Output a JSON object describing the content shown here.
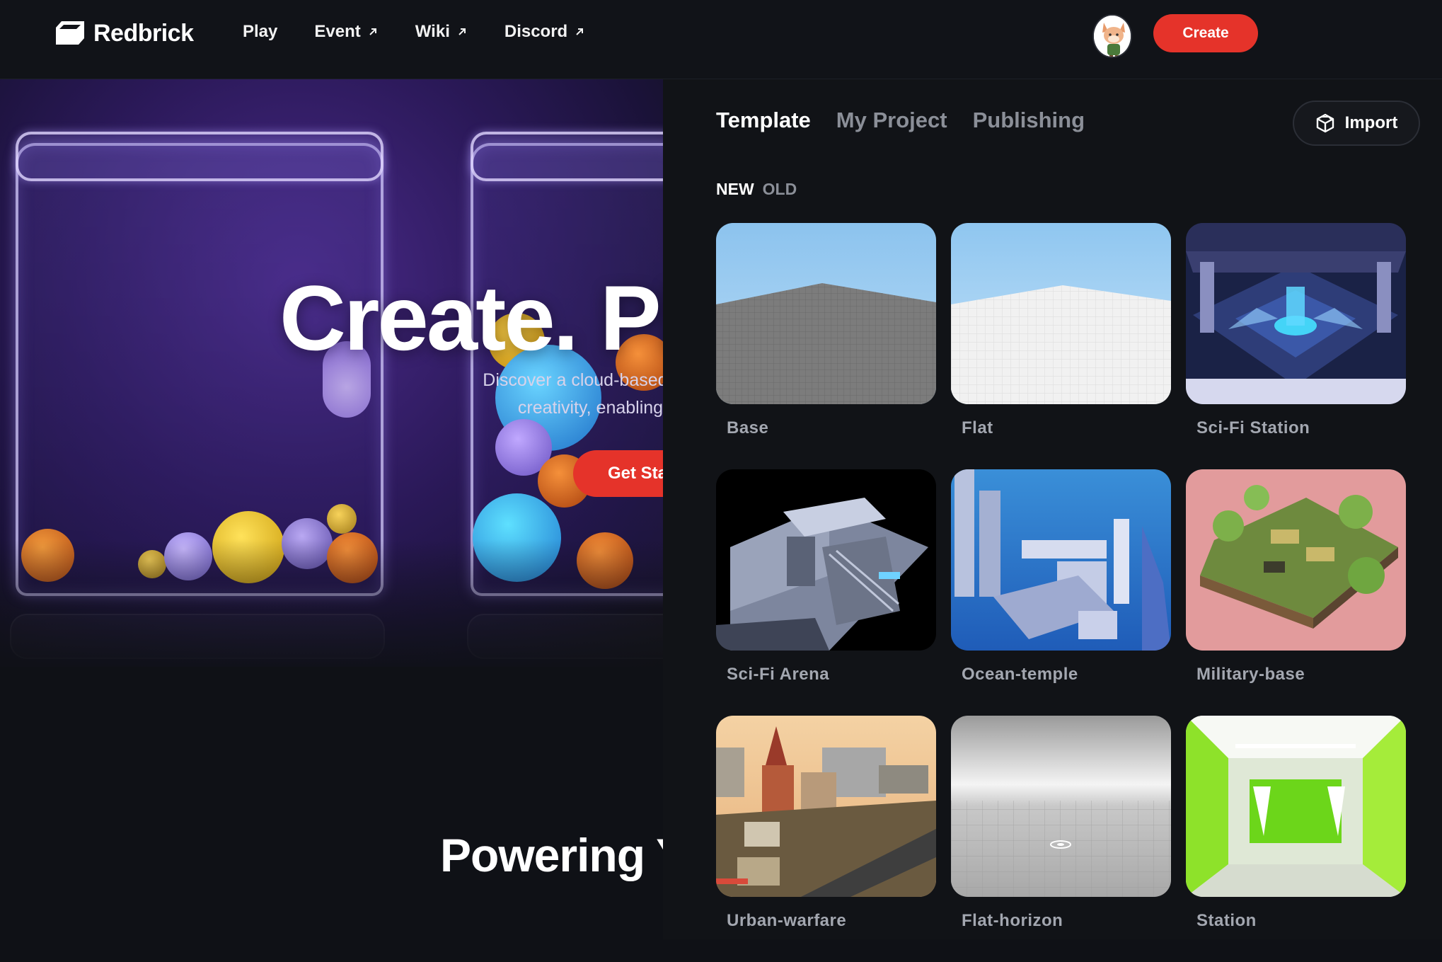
{
  "header": {
    "brand": "Redbrick",
    "nav": [
      {
        "label": "Play",
        "external": false
      },
      {
        "label": "Event",
        "external": true
      },
      {
        "label": "Wiki",
        "external": true
      },
      {
        "label": "Discord",
        "external": true
      }
    ],
    "create_label": "Create"
  },
  "hero": {
    "title": "Create. Pl",
    "subtitle_line1": "Discover a cloud-based reali",
    "subtitle_line2": "creativity, enabling you to",
    "cta_label": "Get Sta",
    "section_heading": "Powering Y"
  },
  "panel": {
    "tabs": [
      {
        "label": "Template",
        "active": true
      },
      {
        "label": "My Project",
        "active": false
      },
      {
        "label": "Publishing",
        "active": false
      }
    ],
    "import_label": "Import",
    "sort": [
      {
        "label": "NEW",
        "active": true
      },
      {
        "label": "OLD",
        "active": false
      }
    ],
    "templates": [
      {
        "label": "Base",
        "icon": "gray-floor-scene"
      },
      {
        "label": "Flat",
        "icon": "white-floor-scene"
      },
      {
        "label": "Sci-Fi Station",
        "icon": "scifi-station-scene"
      },
      {
        "label": "Sci-Fi Arena",
        "icon": "scifi-arena-scene"
      },
      {
        "label": "Ocean-temple",
        "icon": "ocean-temple-scene"
      },
      {
        "label": "Military-base",
        "icon": "military-base-scene"
      },
      {
        "label": "Urban-warfare",
        "icon": "urban-warfare-scene"
      },
      {
        "label": "Flat-horizon",
        "icon": "flat-horizon-scene"
      },
      {
        "label": "Station",
        "icon": "station-scene"
      }
    ]
  },
  "colors": {
    "accent": "#e5332a",
    "background": "#0f1116",
    "panel": "#111317",
    "muted_text": "#8b8f98"
  }
}
